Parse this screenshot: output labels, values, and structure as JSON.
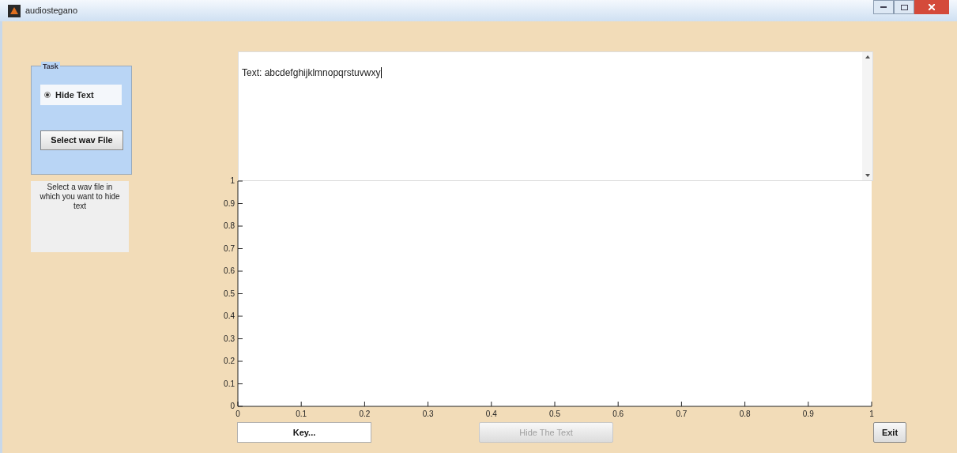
{
  "window": {
    "title": "audiostegano"
  },
  "task_panel": {
    "title": "Task",
    "options": [
      {
        "label": "Hide Text",
        "selected": true
      }
    ],
    "button": "Select wav File"
  },
  "hint": "Select a wav file in which you want to hide text",
  "text_area": {
    "value": "Text: abcdefghijklmnopqrstuvwxy"
  },
  "plot": {
    "chart_data": {
      "type": "line",
      "xlim": [
        0,
        1
      ],
      "ylim": [
        0,
        1
      ],
      "xticks": [
        0,
        0.1,
        0.2,
        0.3,
        0.4,
        0.5,
        0.6,
        0.7,
        0.8,
        0.9,
        1
      ],
      "yticks": [
        0,
        0.1,
        0.2,
        0.3,
        0.4,
        0.5,
        0.6,
        0.7,
        0.8,
        0.9,
        1
      ]
    }
  },
  "buttons": [
    {
      "label": "Key...",
      "kind": "field",
      "disabled": false
    },
    {
      "label": "Hide The Text",
      "kind": "push",
      "disabled": true
    },
    {
      "label": "Exit",
      "kind": "push",
      "disabled": false
    }
  ]
}
